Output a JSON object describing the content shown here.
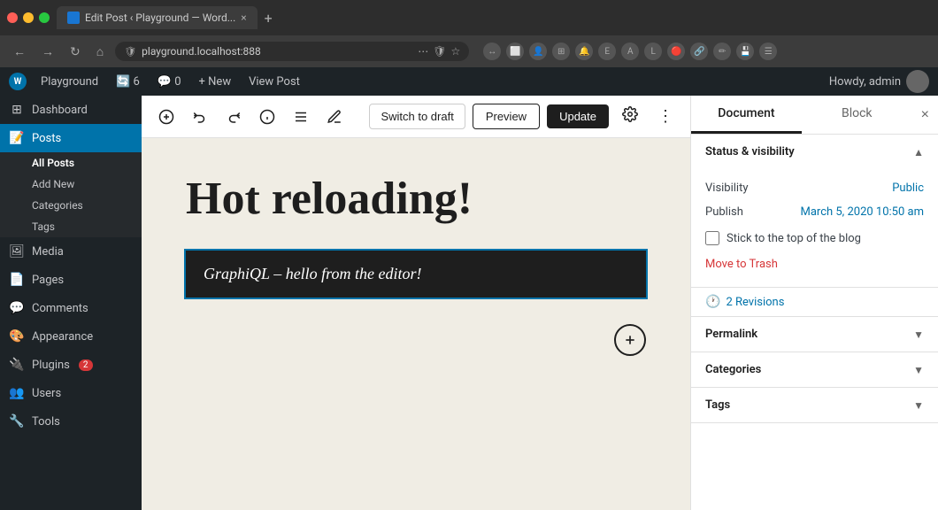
{
  "browser": {
    "tab_title": "Edit Post ‹ Playground — Word...",
    "url": "playground.localhost:888",
    "new_tab_label": "+",
    "nav_back": "←",
    "nav_forward": "→",
    "nav_refresh": "↻",
    "nav_home": "⌂"
  },
  "wp_admin_bar": {
    "wp_logo": "W",
    "site_name": "Playground",
    "updates_count": "6",
    "comments_count": "0",
    "new_label": "+ New",
    "view_post": "View Post",
    "howdy": "Howdy, admin"
  },
  "sidebar": {
    "dashboard_label": "Dashboard",
    "posts_label": "Posts",
    "all_posts_label": "All Posts",
    "add_new_label": "Add New",
    "categories_label": "Categories",
    "tags_label": "Tags",
    "media_label": "Media",
    "pages_label": "Pages",
    "comments_label": "Comments",
    "appearance_label": "Appearance",
    "plugins_label": "Plugins",
    "plugins_badge": "2",
    "users_label": "Users",
    "tools_label": "Tools"
  },
  "editor_toolbar": {
    "add_block_label": "+",
    "undo_label": "↩",
    "redo_label": "↪",
    "info_label": "ⓘ",
    "list_view_label": "≡",
    "tools_label": "✏",
    "switch_to_draft": "Switch to draft",
    "preview": "Preview",
    "update": "Update",
    "settings_label": "⚙",
    "more_label": "⋮"
  },
  "post": {
    "title": "Hot reloading!",
    "block_text": "GraphiQL – hello from the editor!",
    "add_block_btn": "+"
  },
  "right_panel": {
    "tab_document": "Document",
    "tab_block": "Block",
    "close_label": "×",
    "status_visibility_heading": "Status & visibility",
    "visibility_label": "Visibility",
    "visibility_value": "Public",
    "publish_label": "Publish",
    "publish_value": "March 5, 2020 10:50 am",
    "stick_to_top_label": "Stick to the top of the blog",
    "move_to_trash": "Move to Trash",
    "revisions_label": "2 Revisions",
    "permalink_heading": "Permalink",
    "categories_heading": "Categories",
    "tags_heading": "Tags"
  },
  "colors": {
    "accent": "#0073aa",
    "danger": "#d63638",
    "admin_bar_bg": "#1d2327",
    "sidebar_active": "#0073aa",
    "canvas_bg": "#f0ede4",
    "update_btn_bg": "#1e1e1e"
  }
}
